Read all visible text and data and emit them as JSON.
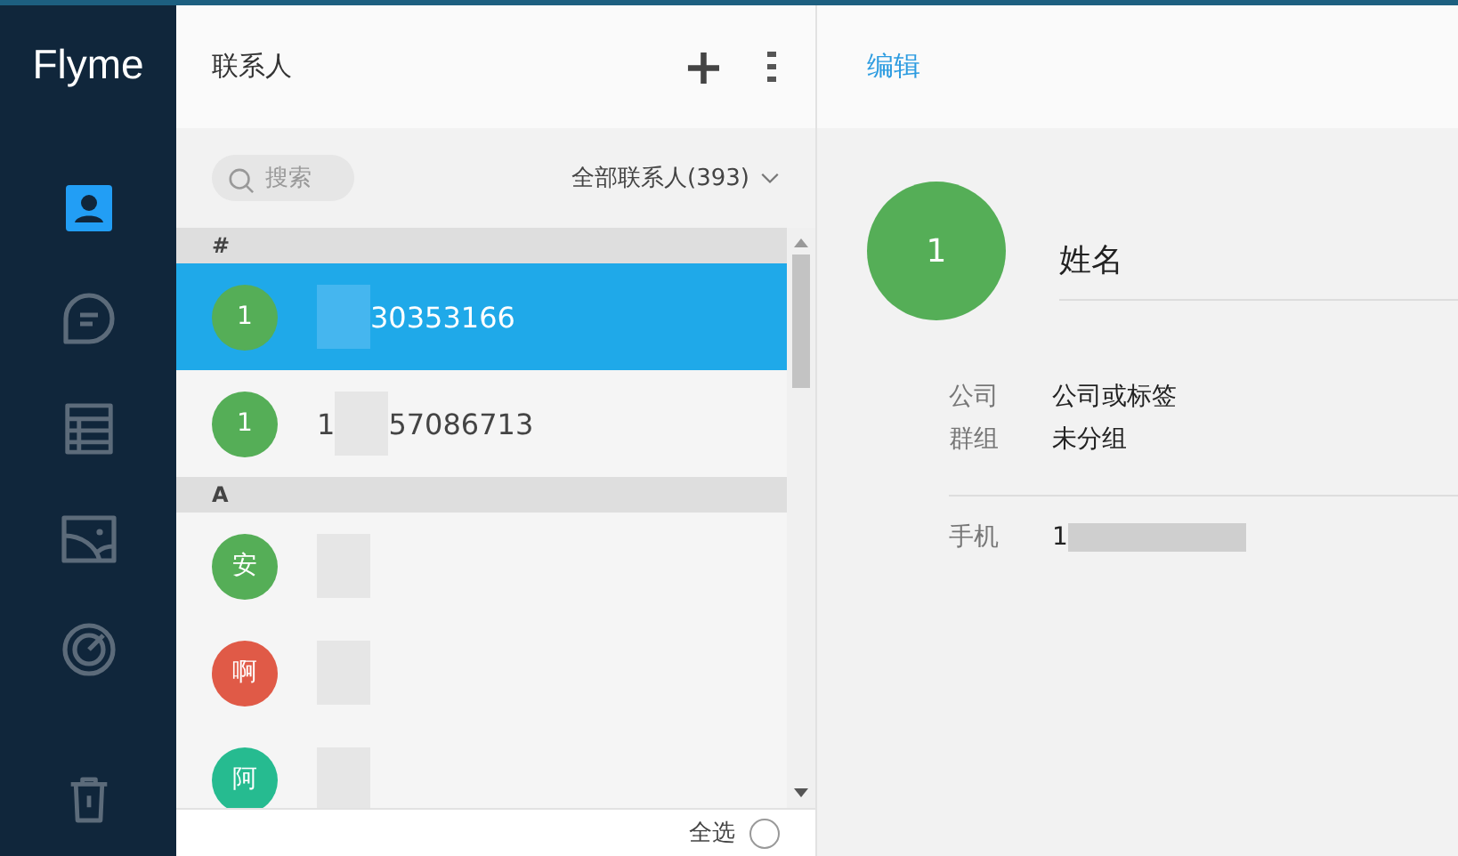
{
  "app": {
    "logo": "Flyme"
  },
  "nav": [
    {
      "kind": "contacts",
      "selected": true
    },
    {
      "kind": "messages",
      "selected": false
    },
    {
      "kind": "table",
      "selected": false
    },
    {
      "kind": "picture",
      "selected": false
    },
    {
      "kind": "radar",
      "selected": false
    },
    {
      "kind": "trash",
      "selected": false
    }
  ],
  "list_header": {
    "title": "联系人",
    "add": "+"
  },
  "search": {
    "placeholder": "搜索"
  },
  "filter": {
    "label": "全部联系人(393)"
  },
  "sections": [
    {
      "letter": "#",
      "contacts": [
        {
          "avatar": "1",
          "color": "#55ae57",
          "after": "30353166",
          "selected": true
        },
        {
          "avatar": "1",
          "color": "#55ae57",
          "before": "1",
          "after": "57086713",
          "selected": false
        }
      ]
    },
    {
      "letter": "A",
      "contacts": [
        {
          "avatar": "安",
          "color": "#55ae57",
          "selected": false
        },
        {
          "avatar": "啊",
          "color": "#e05a47",
          "selected": false
        },
        {
          "avatar": "阿",
          "color": "#26bb90",
          "selected": false
        }
      ]
    }
  ],
  "footer": {
    "select_all": "全选",
    "checked": false
  },
  "detail": {
    "edit": "编辑",
    "avatar": "1",
    "name_placeholder": "姓名",
    "fields": [
      {
        "label": "公司",
        "value": "公司或标签"
      },
      {
        "label": "群组",
        "value": "未分组"
      }
    ],
    "phone": {
      "label": "手机",
      "before": "1"
    }
  }
}
